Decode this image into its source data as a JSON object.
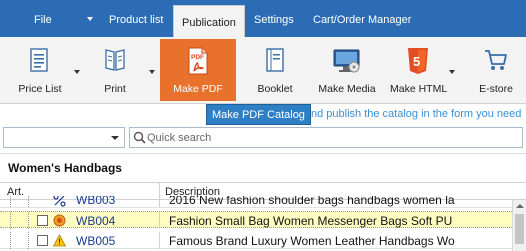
{
  "menu": {
    "file": "File",
    "product_list": "Product list",
    "publication": "Publication",
    "settings": "Settings",
    "cart_order_manager": "Cart/Order Manager"
  },
  "ribbon": {
    "price_list": "Price List",
    "print": "Print",
    "make_pdf": "Make PDF",
    "booklet": "Booklet",
    "make_media": "Make Media",
    "make_html": "Make HTML",
    "e_store": "E-store",
    "pdf_icon_text": "PDF",
    "html_icon_text": "5"
  },
  "tooltip": {
    "text": "Make PDF Catalog",
    "hint": "nd publish the catalog in the form you need"
  },
  "filter": {
    "dropdown_value": "",
    "search_placeholder": "Quick search"
  },
  "group": {
    "title": "Women's Handbags"
  },
  "table": {
    "columns": [
      "Art.",
      "Description"
    ],
    "rows": [
      {
        "code": "WB003",
        "description": "2016 New fashion shoulder bags handbags women la",
        "status": "percent-icon"
      },
      {
        "code": "WB004",
        "description": "Fashion Small Bag Women Messenger Bags Soft PU",
        "status": "award-icon"
      },
      {
        "code": "WB005",
        "description": "Famous Brand Luxury Women Leather Handbags Wo",
        "status": "warning-icon"
      }
    ]
  },
  "colors": {
    "menubar": "#2c6cb4",
    "active_button": "#e8722c",
    "tooltip": "#2e7fc4",
    "selected_row": "#fffdc0"
  }
}
